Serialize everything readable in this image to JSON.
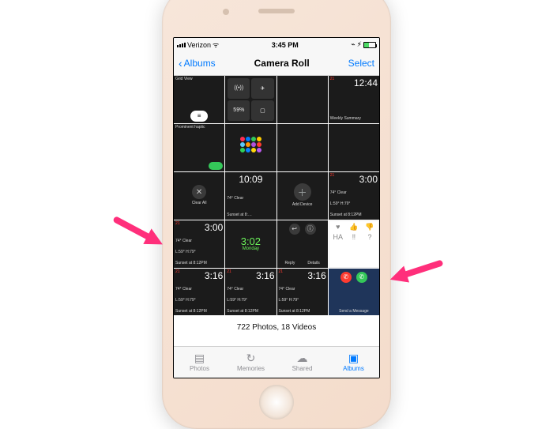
{
  "status": {
    "carrier": "Verizon",
    "wifi": true,
    "time": "3:45 PM",
    "bluetooth": true,
    "battery_glyph": "⚡︎",
    "battery_pct": 40
  },
  "navbar": {
    "back_label": "Albums",
    "title": "Camera Roll",
    "select_label": "Select"
  },
  "thumbs": [
    {
      "kind": "gridview",
      "label": "Grid View"
    },
    {
      "kind": "control_center",
      "battery_text": "59%"
    },
    {
      "kind": "dark"
    },
    {
      "kind": "clock",
      "date": "21",
      "time": "12:44",
      "subtitle": "Weekly Summary"
    },
    {
      "kind": "dark_text",
      "text": "Prominent haptic"
    },
    {
      "kind": "honeycomb"
    },
    {
      "kind": "dark"
    },
    {
      "kind": "dark"
    },
    {
      "kind": "clearall",
      "label": "Clear All"
    },
    {
      "kind": "watch_weather",
      "time": "10:09",
      "temp": "74° Clear",
      "sunset": "Sunset at 8:…"
    },
    {
      "kind": "add_device",
      "label": "Add Device"
    },
    {
      "kind": "clock",
      "date": "21",
      "time": "3:00",
      "forecast": "74° Clear",
      "hilo": "L:59° H:79°",
      "sunset": "Sunset at 8:12PM"
    },
    {
      "kind": "clock",
      "date": "21",
      "time": "3:00",
      "forecast": "74° Clear",
      "hilo": "L:59° H:79°",
      "sunset": "Sunset at 8:12PM"
    },
    {
      "kind": "green_clock",
      "time": "3:02",
      "day": "Monday"
    },
    {
      "kind": "reply_details",
      "left": "Reply",
      "right": "Details"
    },
    {
      "kind": "tapback"
    },
    {
      "kind": "clock",
      "date": "21",
      "time": "3:16",
      "forecast": "74° Clear",
      "hilo": "L:59° H:79°",
      "sunset": "Sunset at 8:12PM"
    },
    {
      "kind": "clock",
      "date": "21",
      "time": "3:16",
      "forecast": "74° Clear",
      "hilo": "L:59° H:79°",
      "sunset": "Sunset at 8:12PM"
    },
    {
      "kind": "clock",
      "date": "21",
      "time": "3:16",
      "forecast": "74° Clear",
      "hilo": "L:59° H:79°",
      "sunset": "Sunset at 8:12PM"
    },
    {
      "kind": "call_msg",
      "label": "Send a Message"
    }
  ],
  "summary": "722 Photos, 18 Videos",
  "tabs": [
    {
      "id": "photos",
      "label": "Photos",
      "icon": "▤",
      "active": false
    },
    {
      "id": "memories",
      "label": "Memories",
      "icon": "↻",
      "active": false
    },
    {
      "id": "shared",
      "label": "Shared",
      "icon": "☁",
      "active": false
    },
    {
      "id": "albums",
      "label": "Albums",
      "icon": "▣",
      "active": true
    }
  ],
  "colors": {
    "ios_blue": "#007aff",
    "ios_green": "#34c759",
    "ios_red": "#ff3b30",
    "arrow": "#ff2f7b"
  }
}
